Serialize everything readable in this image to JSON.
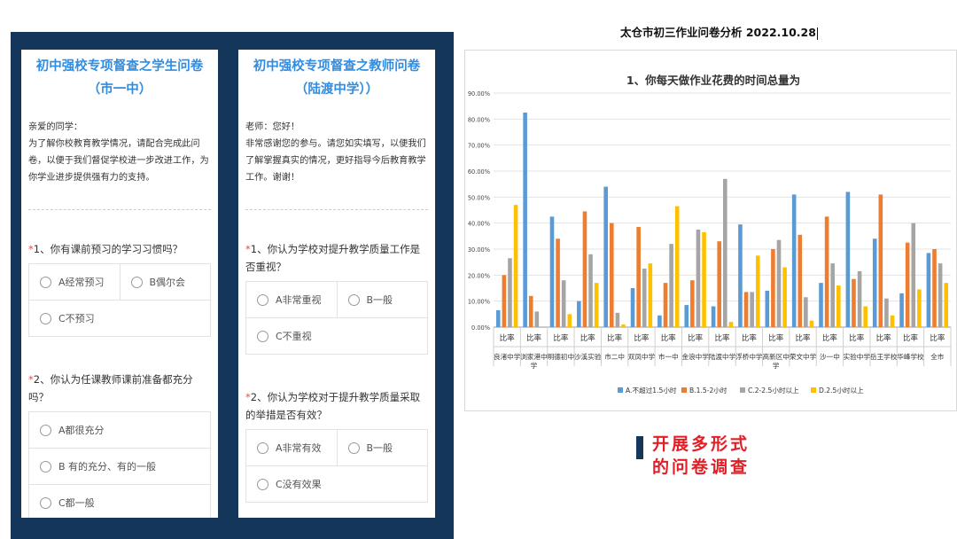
{
  "student_survey": {
    "title_line1": "初中强校专项督查之学生问卷",
    "title_line2": "（市一中）",
    "greeting": "亲爱的同学：",
    "intro": "为了解你校教育教学情况，请配合完成此问卷，以便于我们督促学校进一步改进工作，为你学业进步提供强有力的支持。",
    "questions": [
      {
        "star": "*",
        "text": "1、你有课前预习的学习习惯吗？",
        "options": [
          "A经常预习",
          "B偶尔会",
          "C不预习"
        ]
      },
      {
        "star": "*",
        "text": "2、你认为任课教师课前准备都充分吗？",
        "options": [
          "A都很充分",
          "B 有的充分、有的一般",
          "C都一般"
        ]
      }
    ]
  },
  "teacher_survey": {
    "title_line1": "初中强校专项督查之教师问卷",
    "title_line2": "（陆渡中学））",
    "greeting": "老师：您好！",
    "intro": "非常感谢您的参与。请您如实填写，以便我们了解掌握真实的情况，更好指导今后教育教学工作。谢谢！",
    "questions": [
      {
        "star": "*",
        "text": "1、你认为学校对提升教学质量工作是否重视？",
        "options": [
          "A非常重视",
          "B一般",
          "C不重视"
        ]
      },
      {
        "star": "*",
        "text": "2、你认为学校对于提升教学质量采取的举措是否有效？",
        "options": [
          "A非常有效",
          "B一般",
          "C没有效果"
        ]
      }
    ]
  },
  "report_title": "太仓市初三作业问卷分析 2022.10.28",
  "callout": {
    "line1": "开展多形式",
    "line2": "的问卷调查"
  },
  "colors": {
    "panel": "#15365b",
    "title_blue": "#2f8de4",
    "callout_red": "#e21f26"
  },
  "chart_data": {
    "type": "bar",
    "title": "1、你每天做作业花费的时间总量为",
    "series_group_label": "比率",
    "categories": [
      "良渚中学",
      "浏家港中学",
      "明德初中",
      "沙溪实验",
      "市二中",
      "双凤中学",
      "市一中",
      "金浪中学",
      "陆渡中学",
      "浮桥中学",
      "高新区中学",
      "荣文中学",
      "沙一中",
      "实验中学",
      "岳王学校",
      "华峰学校",
      "全市"
    ],
    "category_lines": [
      [
        "良渚中学"
      ],
      [
        "浏家港中",
        "学"
      ],
      [
        "明德初中"
      ],
      [
        "沙溪实验"
      ],
      [
        "市二中"
      ],
      [
        "双凤中学"
      ],
      [
        "市一中"
      ],
      [
        "金浪中学"
      ],
      [
        "陆渡中学"
      ],
      [
        "浮桥中学"
      ],
      [
        "高新区中",
        "学"
      ],
      [
        "荣文中学"
      ],
      [
        "沙一中"
      ],
      [
        "实验中学"
      ],
      [
        "岳王学校"
      ],
      [
        "华峰学校"
      ],
      [
        "全市"
      ]
    ],
    "series": [
      {
        "name": "A.不超过1.5小时",
        "color": "#5b9bd5",
        "values": [
          6.5,
          82.5,
          42.5,
          10,
          54,
          15,
          4.5,
          8.5,
          8,
          39.5,
          14,
          51,
          17,
          52,
          34,
          13,
          28.5
        ]
      },
      {
        "name": "B.1.5-2小时",
        "color": "#ed7d31",
        "values": [
          20,
          12,
          34,
          44.5,
          40,
          38.5,
          17,
          18,
          33,
          13.5,
          30,
          35.5,
          42.5,
          18.5,
          51,
          32.5,
          30
        ]
      },
      {
        "name": "C.2-2.5小时以上",
        "color": "#a5a5a5",
        "values": [
          26.5,
          6,
          18,
          28,
          5.5,
          22.5,
          32,
          37.5,
          57,
          13.5,
          33.5,
          11.5,
          24.5,
          21.5,
          11,
          40,
          24.5
        ]
      },
      {
        "name": "D.2.5小时以上",
        "color": "#ffc000",
        "values": [
          47,
          0,
          5,
          17,
          1,
          24.5,
          46.5,
          36.5,
          2,
          27.5,
          23,
          2.5,
          16,
          8,
          4.5,
          14.5,
          17
        ]
      }
    ],
    "ylim": [
      0,
      90
    ],
    "yticks": [
      "0.00%",
      "10.00%",
      "20.00%",
      "30.00%",
      "40.00%",
      "50.00%",
      "60.00%",
      "70.00%",
      "80.00%",
      "90.00%"
    ],
    "legend_position": "bottom",
    "grid": true
  }
}
